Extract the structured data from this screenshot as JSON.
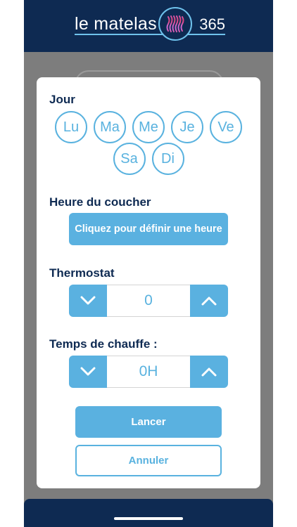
{
  "header": {
    "logo_left": "le matelas",
    "logo_right": "365",
    "logo_icon": "wave-icon",
    "brand_color": "#0e2a52"
  },
  "modal": {
    "day_section_title": "Jour",
    "days": [
      "Lu",
      "Ma",
      "Me",
      "Je",
      "Ve",
      "Sa",
      "Di"
    ],
    "bedtime_title": "Heure du coucher",
    "bedtime_button": "Cliquez pour définir une heure",
    "thermostat_title": "Thermostat",
    "thermostat_value": "0",
    "heating_title": "Temps de chauffe :",
    "heating_value": "0H",
    "launch_button": "Lancer",
    "cancel_button": "Annuler"
  },
  "icons": {
    "decrease": "chevron-down-icon",
    "increase": "chevron-up-icon"
  },
  "colors": {
    "accent": "#5ab1e0",
    "overlay": "#7d7d7d",
    "text_dark": "#0e2a52"
  }
}
